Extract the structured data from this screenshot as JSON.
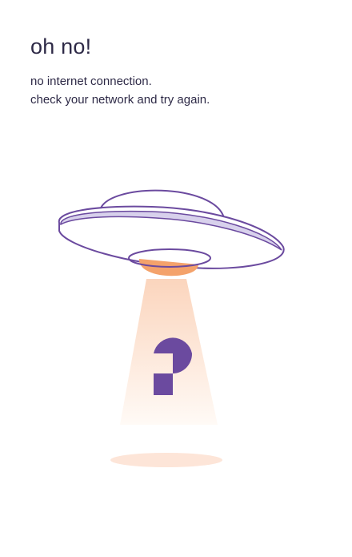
{
  "error_screen": {
    "title": "oh no!",
    "message_lines": [
      "no internet connection.",
      "check your network and try again."
    ]
  },
  "illustration": {
    "icon": "ufo-icon",
    "beam_icon": "tractor-beam-icon",
    "logo_icon": "app-logo-icon",
    "shadow_icon": "ground-shadow-icon"
  },
  "colors": {
    "text": "#2e2a47",
    "outline": "#6b4a9f",
    "dome_fill": "#ffffff",
    "saucer_band": "#d8d1ec",
    "saucer_fill": "#ffffff",
    "ufo_bottom": "#f4a26b",
    "beam_top": "#fbd5bd",
    "beam_bottom": "#fffaf6",
    "logo": "#6b4a9f",
    "shadow": "#fde5d8",
    "background": "#ffffff"
  }
}
